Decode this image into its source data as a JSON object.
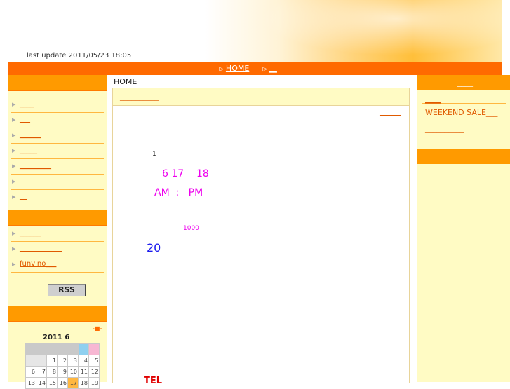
{
  "header": {
    "last_update": "last update 2011/05/23 18:05"
  },
  "nav": {
    "items": [
      {
        "label": "HOME"
      },
      {
        "label": "__"
      }
    ]
  },
  "left": {
    "menu1": [
      "____",
      "___",
      "______",
      "_____",
      "_________",
      "",
      "__"
    ],
    "menu2": [
      "______",
      "____________",
      "funvino___"
    ],
    "rss_label": "RSS",
    "calendar": {
      "title": "2011  6",
      "nav_arrow": "-■-",
      "rows": [
        [
          "",
          "",
          "",
          "",
          "",
          "",
          ""
        ],
        [
          "",
          "",
          "1",
          "2",
          "3",
          "4",
          "5"
        ],
        [
          "6",
          "7",
          "8",
          "9",
          "10",
          "11",
          "12"
        ],
        [
          "13",
          "14",
          "15",
          "16",
          "17",
          "18",
          "19"
        ]
      ]
    }
  },
  "center": {
    "breadcrumb": "HOME",
    "title_link": "__________",
    "side_link": "______",
    "line1": "1",
    "line2": "6 17    18",
    "line3": "AM  :   PM",
    "line4": "1000",
    "line5": "20",
    "tel": "TEL"
  },
  "right": {
    "links": [
      "____",
      "WEEKEND SALE___",
      "__________"
    ],
    "header_link": "____"
  },
  "colors": {
    "accent": "#ff6a00",
    "panel": "#fffbc4",
    "link": "#e05a00",
    "magenta": "#ee00ee",
    "blue": "#1a1aee"
  }
}
